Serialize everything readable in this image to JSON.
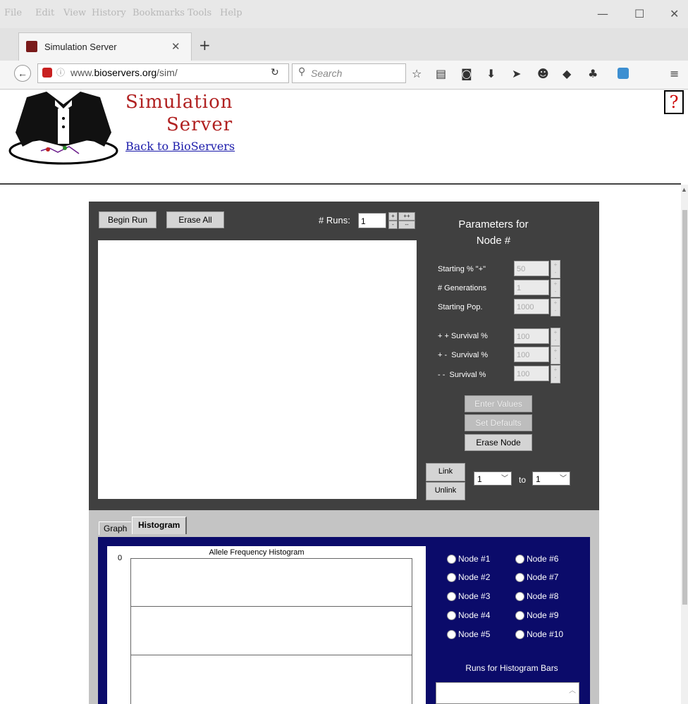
{
  "browser": {
    "menu": [
      "File",
      "Edit",
      "View",
      "History",
      "Bookmarks",
      "Tools",
      "Help"
    ],
    "window_controls": {
      "minimize": "—",
      "maximize": "☐",
      "close": "✕"
    },
    "tab": {
      "title": "Simulation Server",
      "close": "✕",
      "new_tab": "+"
    },
    "url_prefix": "www.",
    "url_domain": "bioservers.org",
    "url_path": "/sim/",
    "search_placeholder": "Search",
    "toolbar_icons": [
      "star-icon",
      "reading-list-icon",
      "pocket-icon",
      "download-icon",
      "send-icon",
      "emoji-icon",
      "extension-icon",
      "puzzle-icon",
      "cloud-icon",
      "hamburger-menu-icon"
    ]
  },
  "header": {
    "title_line1": "Simulation",
    "title_line2": "Server",
    "back_link": "Back to BioServers",
    "help": "?"
  },
  "applet": {
    "begin_run": "Begin Run",
    "erase_all": "Erase All",
    "runs_label": "# Runs:",
    "runs_value": "1",
    "spin_plus": "+",
    "spin_plusplus": "++",
    "spin_minus": "-",
    "spin_minusminus": "--",
    "params_title_1": "Parameters for",
    "params_title_2": "Node #",
    "params": [
      {
        "label": "Starting % \"+\"",
        "value": "50"
      },
      {
        "label": "# Generations",
        "value": "1"
      },
      {
        "label": "Starting Pop.",
        "value": "1000"
      },
      {
        "label": "+ + Survival %",
        "value": "100"
      },
      {
        "label": "+ -  Survival %",
        "value": "100"
      },
      {
        "label": "- -  Survival %",
        "value": "100"
      }
    ],
    "enter_values": "Enter Values",
    "set_defaults": "Set Defaults",
    "erase_node": "Erase Node",
    "link": "Link",
    "unlink": "Unlink",
    "from_node": "1",
    "to_label": "to",
    "to_node": "1"
  },
  "tabs": {
    "graph": "Graph",
    "histogram": "Histogram"
  },
  "histogram": {
    "title": "Allele Frequency Histogram",
    "y_top": "0",
    "nodes": [
      "Node #1",
      "Node #2",
      "Node #3",
      "Node #4",
      "Node #5",
      "Node #6",
      "Node #7",
      "Node #8",
      "Node #9",
      "Node #10"
    ],
    "runs_label": "Runs for Histogram Bars"
  }
}
